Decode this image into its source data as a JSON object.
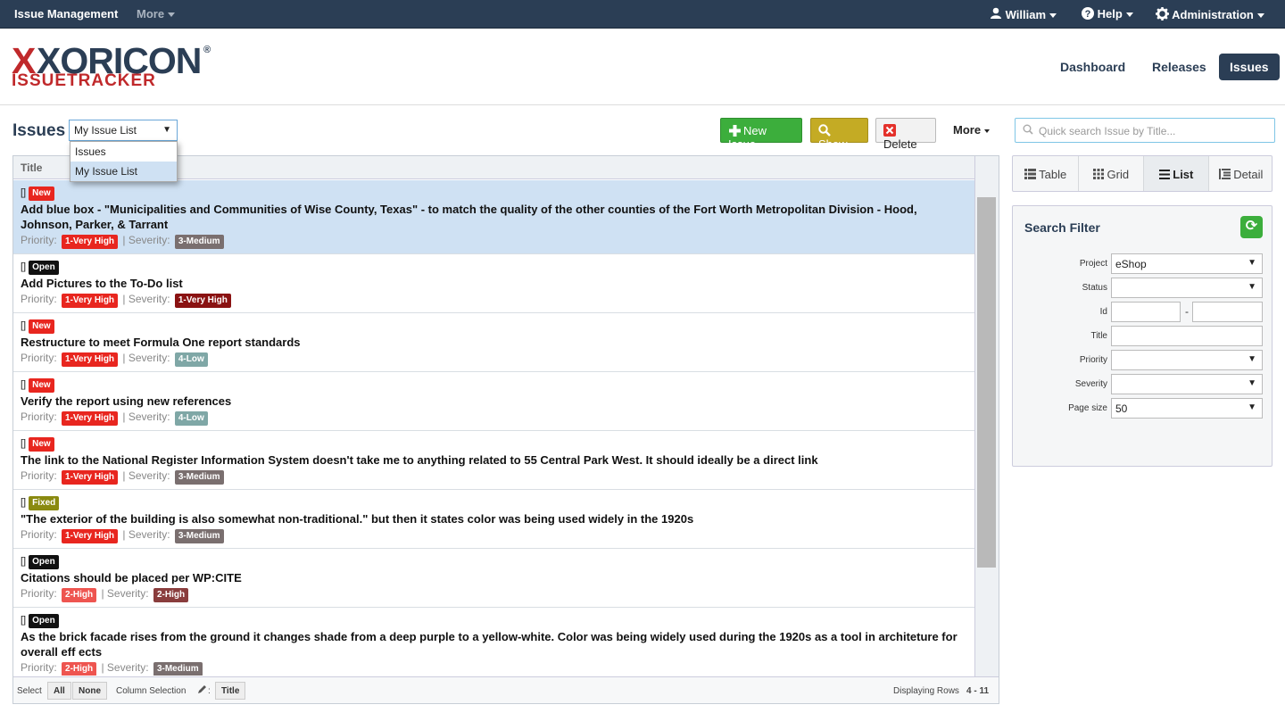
{
  "topbar": {
    "brand": "Issue Management",
    "more": "More",
    "user": "William",
    "help": "Help",
    "admin": "Administration"
  },
  "logo": {
    "name": "XORICON",
    "sub": "ISSUETRACKER",
    "reg": "®"
  },
  "nav": {
    "dashboard": "Dashboard",
    "releases": "Releases",
    "issues": "Issues"
  },
  "page": {
    "title": "Issues",
    "view_selected": "My Issue List",
    "view_options": [
      "Issues",
      "My Issue List"
    ]
  },
  "toolbar": {
    "new": "New Issue",
    "show": "Show",
    "delete": "Delete",
    "more": "More"
  },
  "search": {
    "placeholder": "Quick search Issue by Title..."
  },
  "grid": {
    "column": "Title",
    "priority_label": "Priority:",
    "severity_label": "Severity:",
    "rows": [
      {
        "status": "New",
        "status_color": "#e8261f",
        "title": "Add blue box - \"Municipalities and Communities of Wise County, Texas\" - to match the quality of the other counties of the Fort Worth Metropolitan Division - Hood, Johnson, Parker, & Tarrant",
        "priority": "1-Very High",
        "priority_color": "#e8261f",
        "severity": "3-Medium",
        "severity_color": "#7a6f6f"
      },
      {
        "status": "Open",
        "status_color": "#111111",
        "title": "Add Pictures to the To-Do list",
        "priority": "1-Very High",
        "priority_color": "#e8261f",
        "severity": "1-Very High",
        "severity_color": "#8a1212"
      },
      {
        "status": "New",
        "status_color": "#e8261f",
        "title": "Restructure to meet Formula One report standards",
        "priority": "1-Very High",
        "priority_color": "#e8261f",
        "severity": "4-Low",
        "severity_color": "#7fa7a6"
      },
      {
        "status": "New",
        "status_color": "#e8261f",
        "title": "Verify the report using new references",
        "priority": "1-Very High",
        "priority_color": "#e8261f",
        "severity": "4-Low",
        "severity_color": "#7fa7a6"
      },
      {
        "status": "New",
        "status_color": "#e8261f",
        "title": "The link to the National Register Information System doesn't take me to anything related to 55 Central Park West. It should ideally be a direct link",
        "priority": "1-Very High",
        "priority_color": "#e8261f",
        "severity": "3-Medium",
        "severity_color": "#7a6f6f"
      },
      {
        "status": "Fixed",
        "status_color": "#8a8a10",
        "title": "\"The exterior of the building is also somewhat non-traditional.\" but then it states color was being used widely in the 1920s",
        "priority": "1-Very High",
        "priority_color": "#e8261f",
        "severity": "3-Medium",
        "severity_color": "#7a6f6f"
      },
      {
        "status": "Open",
        "status_color": "#111111",
        "title": "Citations should be placed per WP:CITE",
        "priority": "2-High",
        "priority_color": "#ee5550",
        "severity": "2-High",
        "severity_color": "#8a3d3d"
      },
      {
        "status": "Open",
        "status_color": "#111111",
        "title": "As the brick facade rises from the ground it changes shade from a deep purple to a yellow-white. Color was being widely used during the 1920s as a tool in architeture for overall eff ects",
        "priority": "2-High",
        "priority_color": "#ee5550",
        "severity": "3-Medium",
        "severity_color": "#7a6f6f"
      }
    ]
  },
  "footer": {
    "select": "Select",
    "all": "All",
    "none": "None",
    "column_selection": "Column Selection",
    "col_title": "Title",
    "displaying": "Displaying Rows",
    "range": "4 - 11"
  },
  "views": {
    "table": "Table",
    "grid": "Grid",
    "list": "List",
    "detail": "Detail"
  },
  "filter": {
    "title": "Search Filter",
    "project_label": "Project",
    "project_value": "eShop",
    "status_label": "Status",
    "id_label": "Id",
    "id_sep": "-",
    "title_label": "Title",
    "priority_label": "Priority",
    "severity_label": "Severity",
    "pagesize_label": "Page size",
    "pagesize_value": "50"
  }
}
